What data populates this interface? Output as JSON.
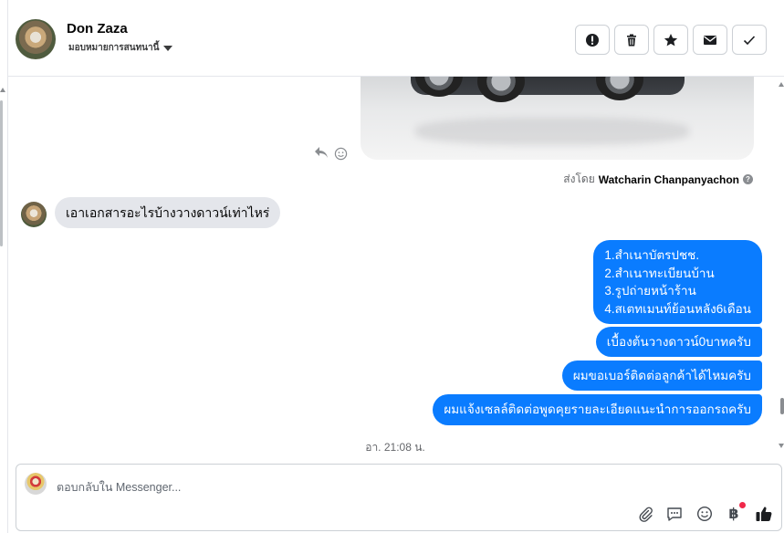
{
  "header": {
    "name": "Don Zaza",
    "assign_label": "มอบหมายการสนทนานี้",
    "actions": [
      "alert-icon",
      "trash-icon",
      "star-icon",
      "mail-icon",
      "check-icon"
    ]
  },
  "conversation": {
    "sent_by_prefix": "ส่งโดย",
    "sent_by_name": "Watcharin Chanpanyachon",
    "incoming_message": "เอาเอกสารอะไรบ้างวางดาวน์เท่าไหร่",
    "outgoing_list": [
      "1.สำเนาบัตรปชช.",
      "2.สำเนาทะเบียนบ้าน",
      "3.รูปถ่ายหน้าร้าน",
      "4.สเตทเมนท์ย้อนหลัง6เดือน"
    ],
    "outgoing_messages": [
      "เบื้องต้นวางดาวน์0บาทครับ",
      "ผมขอเบอร์ติดต่อลูกค้าได้ไหมครับ",
      "ผมแจ้งเซลล์ติดต่อพูดคุยรายละเอียดแนะนำการออกรถครับ"
    ],
    "timestamp": "อา. 21:08 น."
  },
  "composer": {
    "placeholder": "ตอบกลับใน Messenger...",
    "tools": [
      "paperclip-icon",
      "saved-reply-icon",
      "emoji-icon",
      "baht-icon",
      "like-icon"
    ],
    "baht_symbol": "฿"
  },
  "colors": {
    "accent": "#0a7cff",
    "incoming_bubble": "#e4e6eb",
    "notification_dot": "#f02849"
  }
}
